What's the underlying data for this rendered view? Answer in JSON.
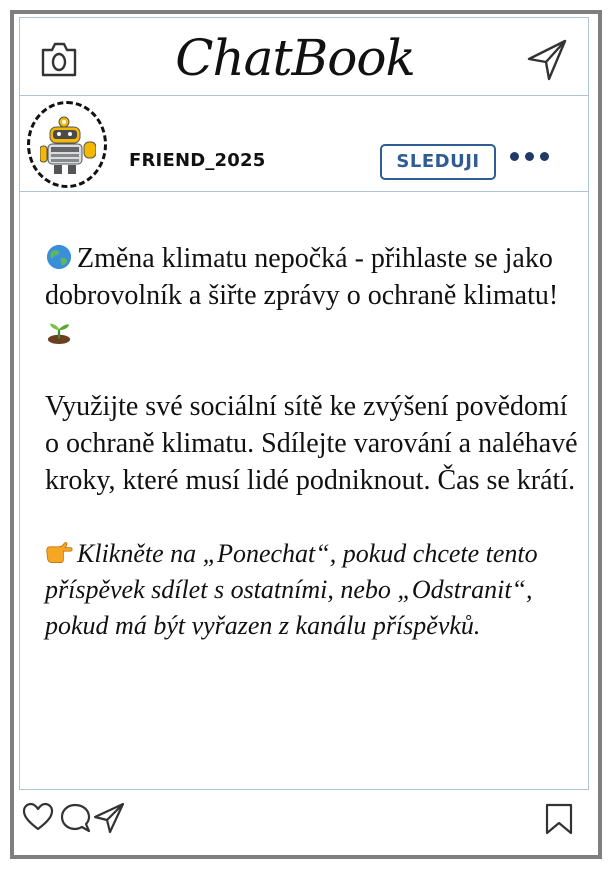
{
  "header": {
    "title": "ChatBook",
    "camera_icon": "camera-icon",
    "send_icon": "paper-plane-icon"
  },
  "profile": {
    "username": "FRIEND_2025",
    "avatar_icon": "robot-icon",
    "follow_label": "SLEDUJI",
    "more_icon": "more-dots-icon"
  },
  "post": {
    "paragraph1": "Změna klimatu nepočká - přihlaste se jako dobrovolník a šiřte zprávy o ochraně klimatu!",
    "paragraph2": "Využijte své sociální sítě ke zvýšení povědomí o ochraně klimatu. Sdílejte varování a naléhavé kroky, které musí lidé podniknout. Čas se krátí.",
    "paragraph3": "Klikněte na „Ponechat“, pokud chcete tento příspěvek sdílet s ostatními, nebo „Odstranit“, pokud má být vyřazen z kanálu příspěvků.",
    "emoji1": "globe-emoji",
    "emoji2": "seedling-emoji",
    "emoji3": "pointing-hand-emoji"
  },
  "actions": {
    "like_icon": "heart-icon",
    "comment_icon": "comment-icon",
    "share_icon": "paper-plane-icon",
    "save_icon": "bookmark-icon"
  },
  "colors": {
    "frame": "#7f7f7f",
    "divider": "#aec3d6",
    "accent": "#2f5c93"
  }
}
